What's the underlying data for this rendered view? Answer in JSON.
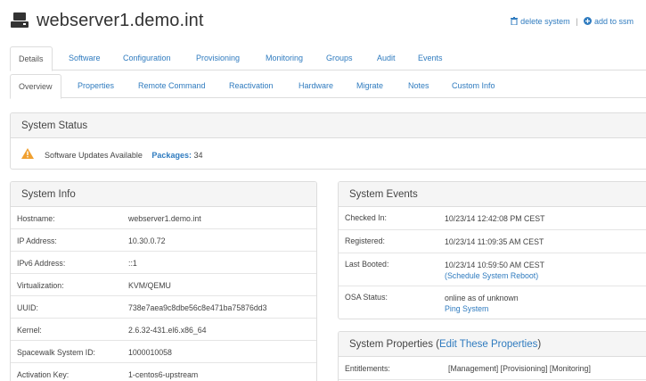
{
  "header": {
    "title": "webserver1.demo.int",
    "delete_label": "delete system",
    "separator": "|",
    "ssm_label": "add to ssm"
  },
  "tabs_primary": [
    "Details",
    "Software",
    "Configuration",
    "Provisioning",
    "Monitoring",
    "Groups",
    "Audit",
    "Events"
  ],
  "tabs_secondary": [
    "Overview",
    "Properties",
    "Remote Command",
    "Reactivation",
    "Hardware",
    "Migrate",
    "Notes",
    "Custom Info"
  ],
  "status": {
    "title": "System Status",
    "message": "Software Updates Available",
    "packages_label": "Packages:",
    "packages_count": "34"
  },
  "system_info": {
    "title": "System Info",
    "rows": [
      {
        "key": "Hostname:",
        "value": "webserver1.demo.int"
      },
      {
        "key": "IP Address:",
        "value": "10.30.0.72"
      },
      {
        "key": "IPv6 Address:",
        "value": "::1"
      },
      {
        "key": "Virtualization:",
        "value": "KVM/QEMU"
      },
      {
        "key": "UUID:",
        "value": "738e7aea9c8dbe56c8e471ba75876dd3"
      },
      {
        "key": "Kernel:",
        "value": "2.6.32-431.el6.x86_64"
      },
      {
        "key": "Spacewalk System ID:",
        "value": "1000010058"
      },
      {
        "key": "Activation Key:",
        "value": "1-centos6-upstream"
      }
    ]
  },
  "system_events": {
    "title": "System Events",
    "rows": [
      {
        "key": "Checked In:",
        "value": "10/23/14 12:42:08 PM CEST"
      },
      {
        "key": "Registered:",
        "value": "10/23/14 11:09:35 AM CEST"
      },
      {
        "key": "Last Booted:",
        "value": "10/23/14 10:59:50 AM CEST",
        "open": "(",
        "link": "Schedule System Reboot",
        "close": ")"
      },
      {
        "key": "OSA Status:",
        "value": "online as of unknown",
        "link": "Ping System"
      }
    ]
  },
  "system_properties": {
    "title": "System Properties",
    "paren_open": "(",
    "edit_link": "Edit These Properties",
    "paren_close": ")",
    "rows": [
      {
        "key": "Entitlements:",
        "value": "[Management] [Provisioning] [Monitoring]"
      }
    ]
  },
  "colors": {
    "link": "#2f7bbf",
    "warning": "#f0a030",
    "panel_header_bg": "#f5f5f5",
    "border": "#dddddd"
  },
  "icons": {
    "server": "server-icon",
    "delete": "trash-icon",
    "ssm": "plus-circle-icon",
    "warning": "warning-triangle-icon"
  }
}
